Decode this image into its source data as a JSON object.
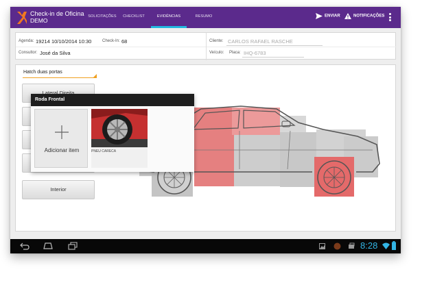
{
  "app": {
    "title_line1": "Check-in de Oficina",
    "title_line2": "DEMO"
  },
  "tabs": [
    {
      "label": "SOLICITAÇÕES",
      "active": false
    },
    {
      "label": "CHECKLIST",
      "active": false
    },
    {
      "label": "EVIDÊNCIAS",
      "active": true
    },
    {
      "label": "RESUMO",
      "active": false
    }
  ],
  "actions": {
    "send_label": "ENVIAR",
    "notifications_label": "NOTIFICAÇÕES",
    "send_icon": "send-icon",
    "notifications_icon": "warning-icon"
  },
  "info": {
    "agenda_label": "Agenda:",
    "agenda_value": "19214  10/10/2014  10:30",
    "checkin_label": "Check-In:",
    "checkin_value": "68",
    "consultor_label": "Consultor:",
    "consultor_value": "José da Silva",
    "cliente_label": "Cliente:",
    "cliente_value": "CARLOS RAFAEL RASCHE",
    "veiculo_label": "Veículo:",
    "placa_label": "Placa:",
    "placa_value": "IHQ-6783"
  },
  "vehicle_type": "Hatch duas portas",
  "side_buttons": [
    {
      "label": "Lateral Direita"
    },
    {
      "label": ""
    },
    {
      "label": ""
    },
    {
      "label": ""
    },
    {
      "label": "Interior"
    }
  ],
  "popup": {
    "title": "Roda Frontal",
    "add_label": "Adicionar item",
    "photos": [
      {
        "caption": "PNEU CARECA"
      }
    ]
  },
  "status_bar": {
    "time": "8:28"
  },
  "colors": {
    "appbar": "#5b2a8c",
    "tab_indicator": "#23b8e0",
    "highlight_damage": "#e06060",
    "select_accent": "#f0a020",
    "clock": "#33b5e5"
  }
}
